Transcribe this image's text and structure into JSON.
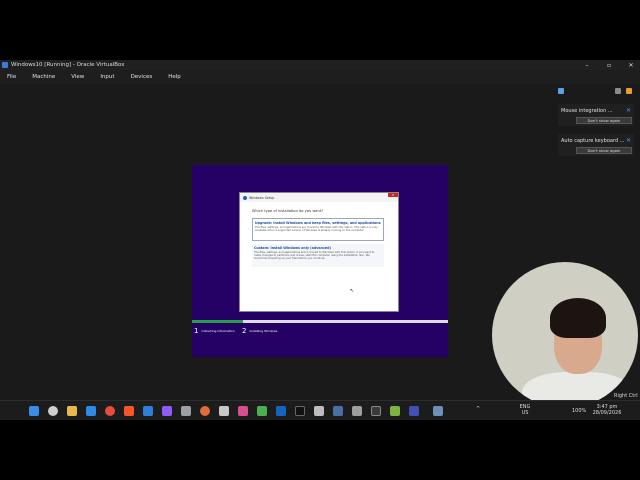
{
  "window": {
    "title": "Windows10 [Running] - Oracle VirtualBox",
    "controls": [
      "–",
      "▫",
      "✕"
    ]
  },
  "menu": [
    "File",
    "Machine",
    "View",
    "Input",
    "Devices",
    "Help"
  ],
  "setup": {
    "title": "Windows Setup",
    "question": "Which type of installation do you want?",
    "upgrade": {
      "heading": "Upgrade: Install Windows and keep files, settings, and applications",
      "description": "The files, settings, and applications are moved to Windows with this option. This option is only available when a supported version of Windows is already running on the computer."
    },
    "custom": {
      "heading": "Custom: Install Windows only (advanced)",
      "description": "The files, settings, and applications aren't moved to Windows with this option. If you want to make changes to partitions and drives, start the computer using the installation disc. We recommend backing up your files before you continue."
    },
    "progress": 0.2,
    "steps": [
      {
        "num": "1",
        "label": "Collecting information"
      },
      {
        "num": "2",
        "label": "Installing Windows"
      }
    ]
  },
  "notifications": [
    {
      "title": "Mouse integration ...",
      "button": "Don't show again"
    },
    {
      "title": "Auto capture keyboard ...",
      "button": "Don't show again"
    }
  ],
  "host_key": "Right Ctrl",
  "tray": {
    "lang": "ENG",
    "region": "US",
    "battery": "100%",
    "time": "3:47 pm",
    "date": "28/09/2026"
  },
  "colors": {
    "guest_bg": "#250065",
    "link_blue": "#1f4ea8",
    "progress_green": "#2a9d4a"
  }
}
